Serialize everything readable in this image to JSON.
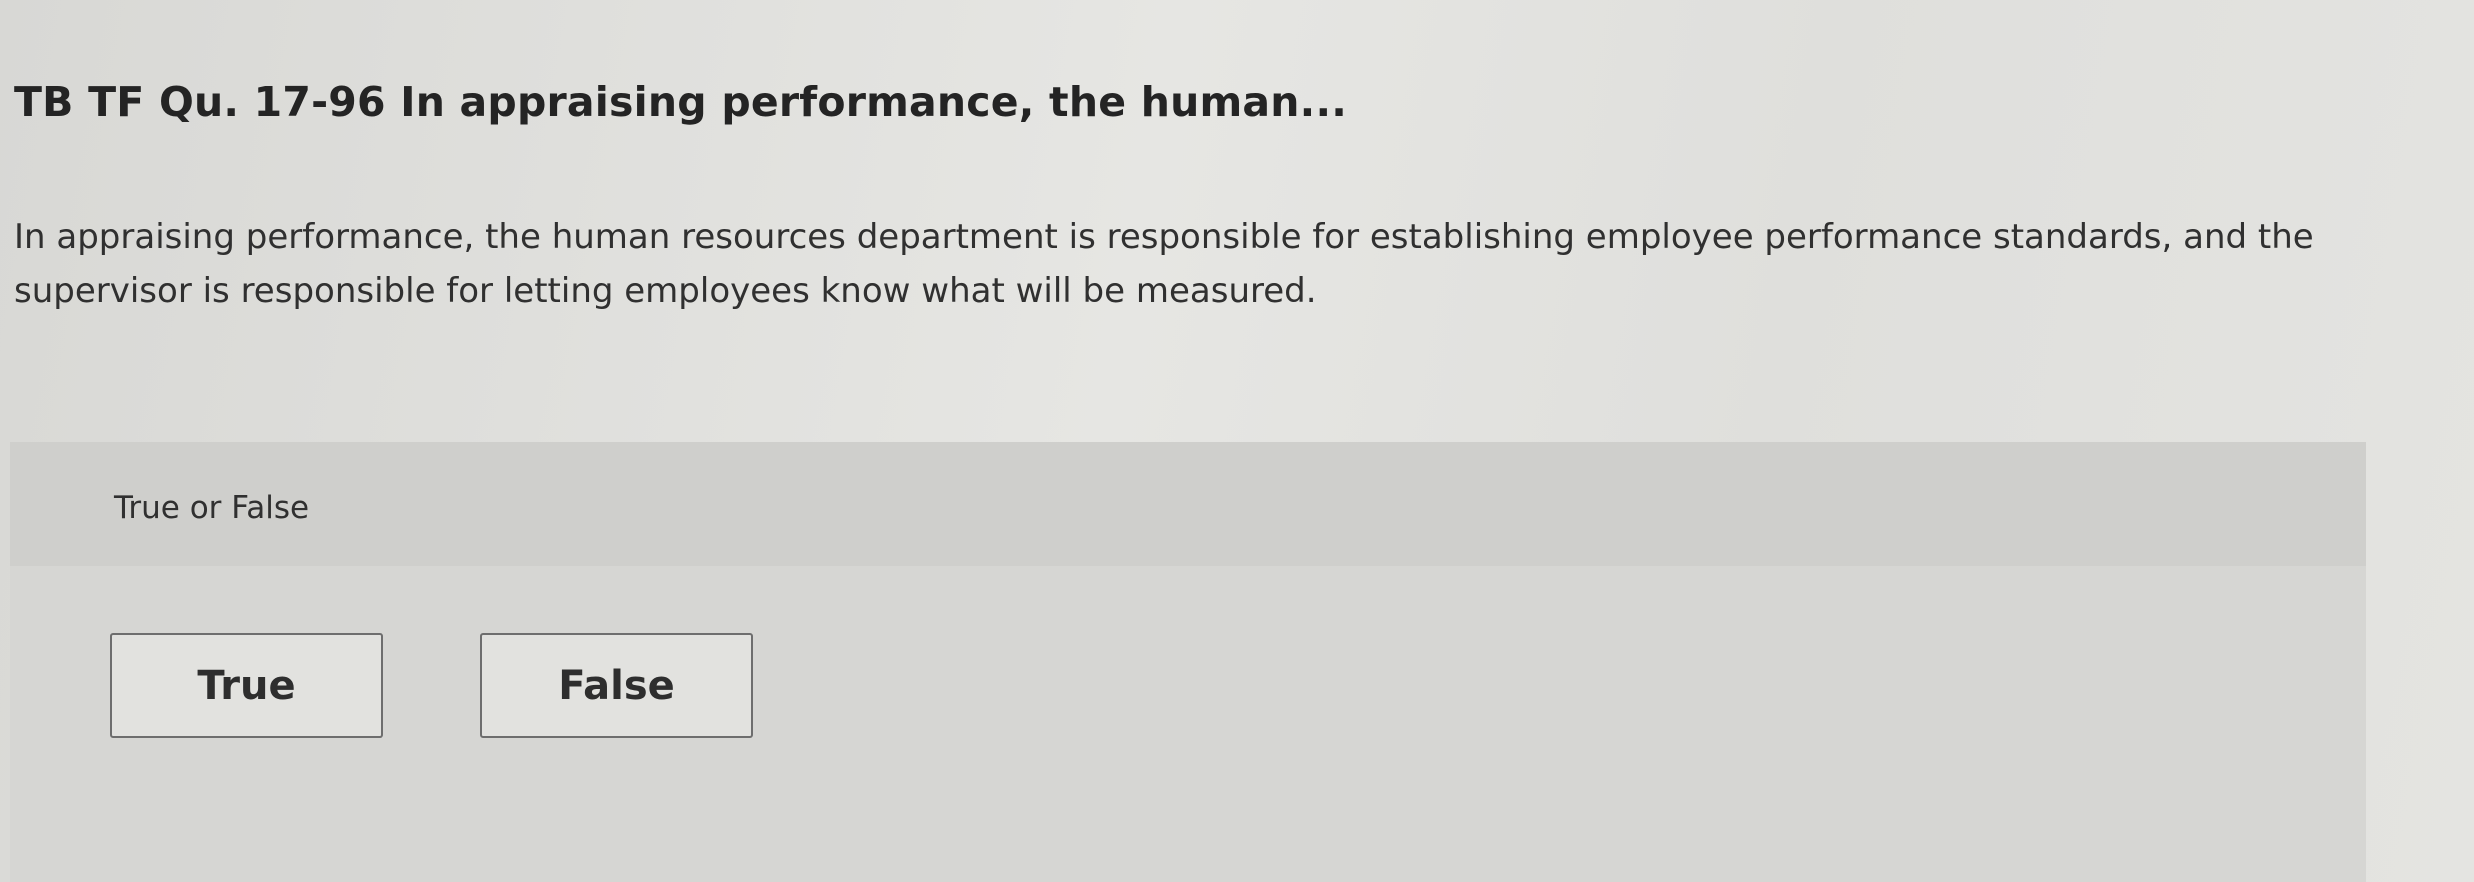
{
  "question": {
    "title": "TB TF Qu. 17-96 In appraising performance, the human...",
    "text": "In appraising performance, the human resources department is responsible for establishing employee performance standards, and the supervisor is responsible for letting employees know what will be measured."
  },
  "answer": {
    "prompt": "True or False",
    "choices": [
      {
        "label": "True"
      },
      {
        "label": "False"
      }
    ]
  }
}
